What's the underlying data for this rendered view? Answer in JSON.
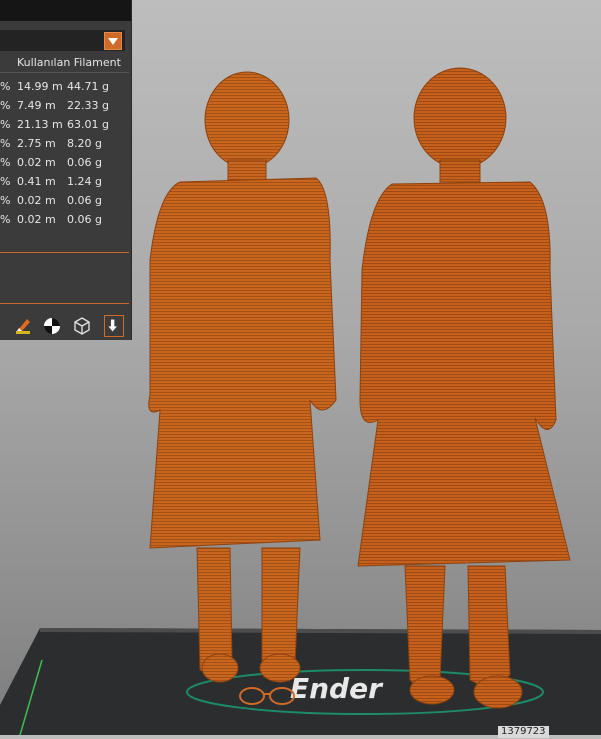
{
  "panel": {
    "column_header": "Kullanılan Filament",
    "rows": [
      {
        "pct": "%",
        "length": "14.99 m",
        "weight": "44.71 g"
      },
      {
        "pct": "%",
        "length": "7.49 m",
        "weight": "22.33 g"
      },
      {
        "pct": "%",
        "length": "21.13 m",
        "weight": "63.01 g"
      },
      {
        "pct": "%",
        "length": "2.75 m",
        "weight": "8.20 g"
      },
      {
        "pct": "%",
        "length": "0.02 m",
        "weight": "0.06 g"
      },
      {
        "pct": "%",
        "length": "0.41 m",
        "weight": "1.24 g"
      },
      {
        "pct": "%",
        "length": "0.02 m",
        "weight": "0.06 g"
      },
      {
        "pct": "%",
        "length": "0.02 m",
        "weight": "0.06 g"
      }
    ],
    "icons": [
      "paint-brush-icon",
      "half-circle-icon",
      "cube-wireframe-icon",
      "download-arrow-icon"
    ],
    "accent_color": "#d06a28"
  },
  "viewport": {
    "model_color": "#c8651f",
    "bed_color": "#2b2d2e",
    "bed_logo_text": "Ender",
    "coordinate_readout": "1379723"
  }
}
